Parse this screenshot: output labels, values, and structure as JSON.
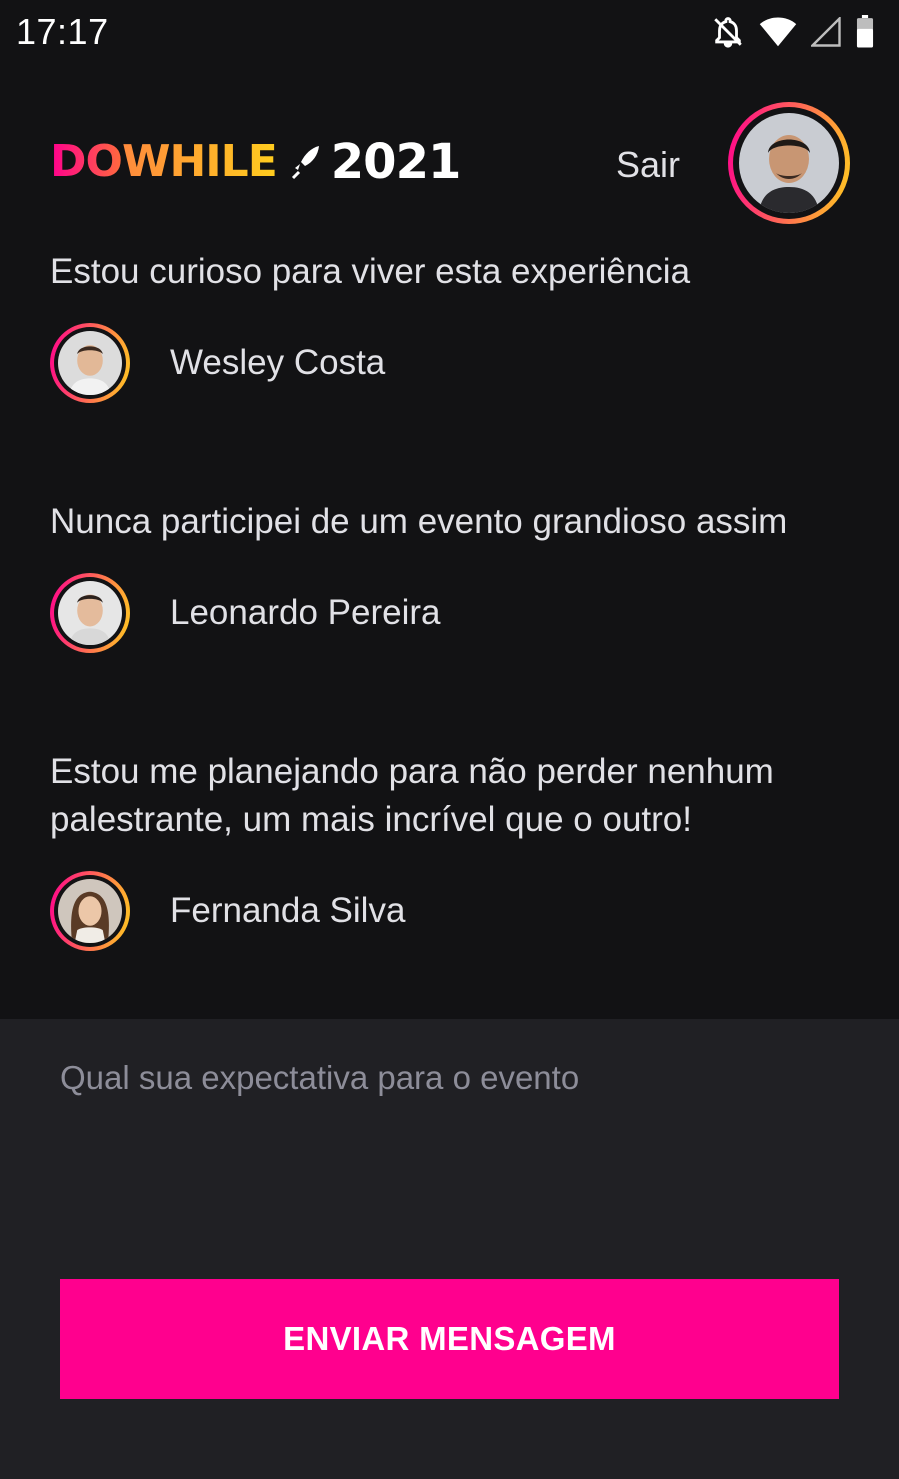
{
  "status_bar": {
    "time": "17:17",
    "icons": [
      "notifications-off-icon",
      "wifi-icon",
      "cellular-signal-icon",
      "battery-icon"
    ]
  },
  "header": {
    "logo": {
      "part_do": "DO",
      "part_while": "WHILE",
      "year": "2021"
    },
    "signout_label": "Sair"
  },
  "messages": [
    {
      "text": "Estou curioso para viver esta experiência",
      "author": "Wesley Costa"
    },
    {
      "text": "Nunca participei de um evento grandioso assim",
      "author": "Leonardo Pereira"
    },
    {
      "text": "Estou me planejando para não perder nenhum palestrante, um mais incrível que o outro!",
      "author": "Fernanda Silva"
    }
  ],
  "composer": {
    "placeholder": "Qual sua expectativa para o evento",
    "value": "",
    "send_label": "ENVIAR MENSAGEM"
  },
  "colors": {
    "background": "#121214",
    "composer_background": "#202024",
    "accent": "#ff008e",
    "gradient_start": "#ff008e",
    "gradient_end": "#ffcd1e",
    "text": "#e1e1e6",
    "placeholder": "#8d8d99"
  }
}
